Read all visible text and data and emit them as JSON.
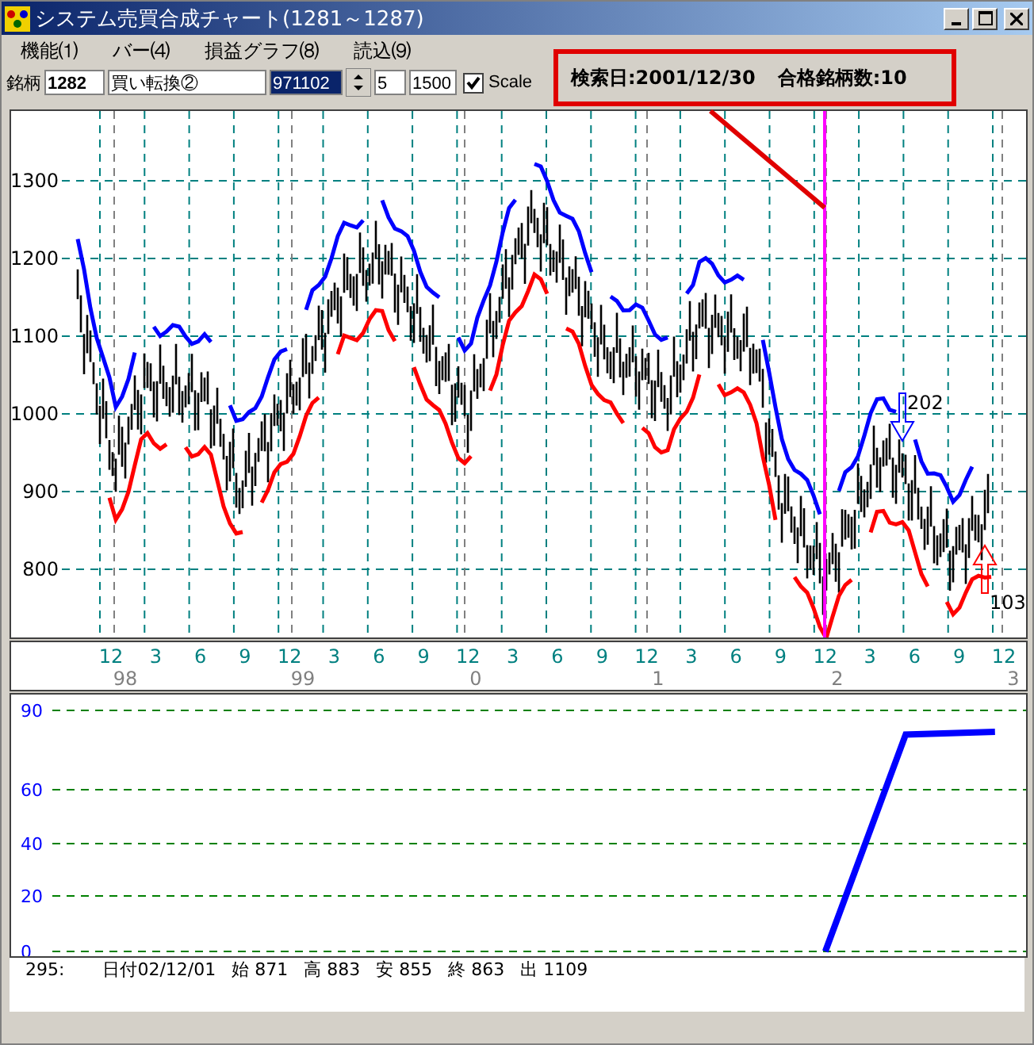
{
  "window": {
    "title": "システム売買合成チャート(1281～1287)"
  },
  "menu": [
    {
      "label": "機能⑴"
    },
    {
      "label": "バー⑷"
    },
    {
      "label": "損益グラフ⑻"
    },
    {
      "label": "読込⑼"
    }
  ],
  "toolbar": {
    "label": "銘柄",
    "code": "1282",
    "strategy": "買い転換②",
    "date": {
      "value": "971102",
      "highlighted": true
    },
    "period": "5",
    "amount": "1500",
    "scale": {
      "label": "Scale",
      "checked": true
    }
  },
  "callout": {
    "search_date": "検索日:2001/12/30",
    "count": "合格銘柄数:10"
  },
  "price_chart": {
    "y_labels": [
      "1300",
      "1200",
      "1100",
      "1000",
      "900",
      "800"
    ],
    "signals": [
      {
        "kind": "sell",
        "label": "202"
      },
      {
        "kind": "buy",
        "label": "103"
      }
    ]
  },
  "time_axis": {
    "months": [
      "12",
      "3",
      "6",
      "9",
      "12",
      "3",
      "6",
      "9",
      "12",
      "3",
      "6",
      "9",
      "12",
      "3",
      "6",
      "9",
      "12",
      "3",
      "6",
      "9",
      "12"
    ],
    "years": [
      "98",
      "99",
      "0",
      "1",
      "2",
      "3"
    ]
  },
  "profit_chart": {
    "y_labels": [
      "90",
      "60",
      "40",
      "20",
      "0"
    ]
  },
  "status_bar": {
    "index": "295:",
    "date": "日付02/12/01",
    "open": "始 871",
    "high": "高 883",
    "low": "安 855",
    "close": "終 863",
    "volume": "出 1109"
  }
}
